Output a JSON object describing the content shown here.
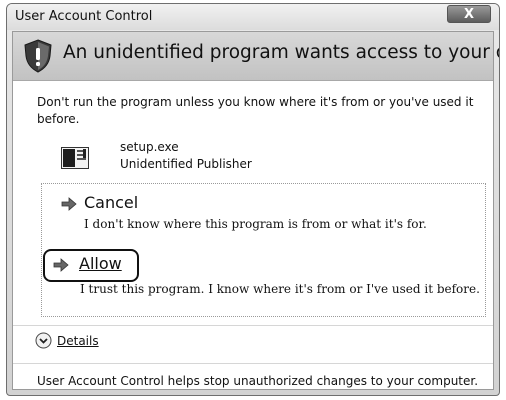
{
  "window": {
    "title": "User Account Control",
    "close_glyph": "X"
  },
  "header": {
    "text": "An unidentified program wants access to your computer",
    "icon": "shield-warning-icon"
  },
  "warning": {
    "text": "Don't run the program unless you know where it's from or you've used it before."
  },
  "program": {
    "name": "setup.exe",
    "publisher": "Unidentified Publisher",
    "icon": "program-icon"
  },
  "options": {
    "cancel": {
      "title": "Cancel",
      "description": "I don't know where this program is from or what it's for."
    },
    "allow": {
      "title": "Allow",
      "description": "I trust this program. I know where it's from or I've used it before."
    }
  },
  "details": {
    "label": "Details",
    "icon": "chevron-down-circle-icon"
  },
  "footer": {
    "text": "User Account Control helps stop unauthorized changes to your computer."
  }
}
